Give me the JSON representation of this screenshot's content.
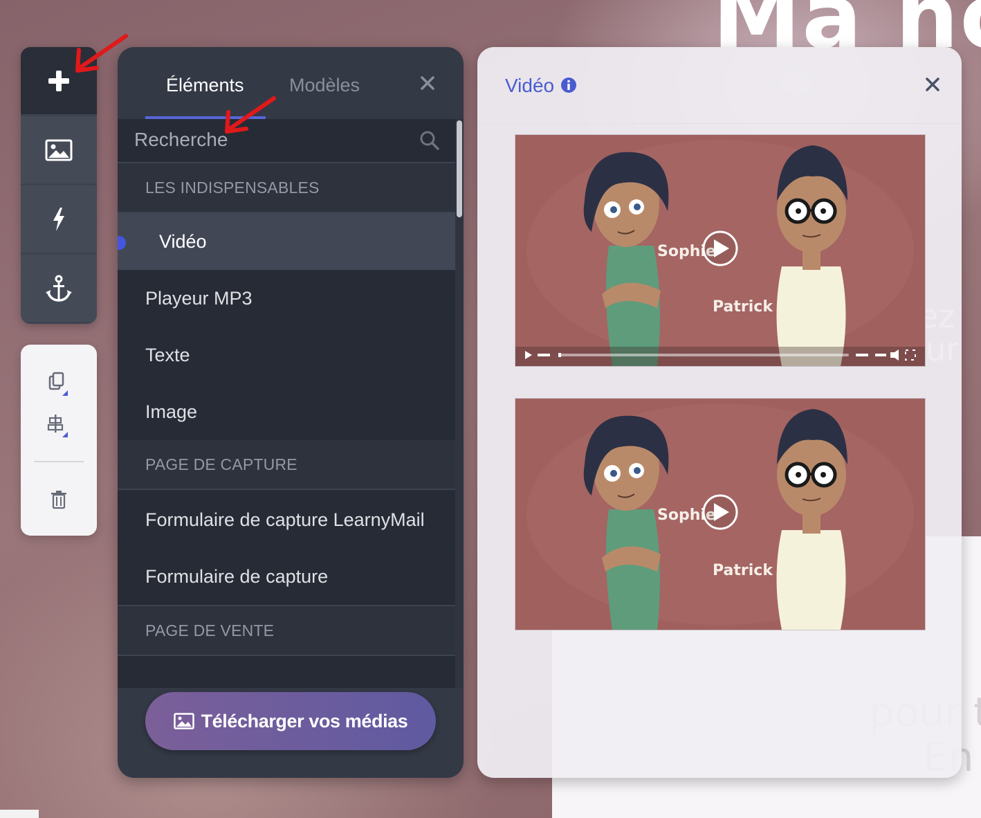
{
  "background": {
    "heading": "Ma no",
    "fragment_1": "rez",
    "fragment_2": "our",
    "fragment_3": "pour t",
    "fragment_4": "En"
  },
  "toolbar": {
    "buttons": [
      {
        "icon": "plus-icon"
      },
      {
        "icon": "image-icon"
      },
      {
        "icon": "lightning-icon"
      },
      {
        "icon": "anchor-icon"
      }
    ],
    "secondary": [
      {
        "icon": "copy-icon"
      },
      {
        "icon": "align-icon"
      },
      {
        "icon": "trash-icon"
      }
    ]
  },
  "panel": {
    "tabs": [
      {
        "label": "Éléments",
        "active": true
      },
      {
        "label": "Modèles",
        "active": false
      }
    ],
    "search_placeholder": "Recherche",
    "sections": [
      {
        "title": "LES INDISPENSABLES",
        "items": [
          "Vidéo",
          "Playeur MP3",
          "Texte",
          "Image"
        ]
      },
      {
        "title": "PAGE DE CAPTURE",
        "items": [
          "Formulaire de capture LearnyMail",
          "Formulaire de capture"
        ]
      },
      {
        "title": "PAGE DE VENTE",
        "items": []
      }
    ],
    "selected_item": "Vidéo",
    "upload_label": "Télécharger vos médias"
  },
  "video_panel": {
    "title": "Vidéo",
    "thumbnails": [
      {
        "name_left": "Sophie",
        "name_right": "Patrick",
        "has_controls": true
      },
      {
        "name_left": "Sophie",
        "name_right": "Patrick",
        "has_controls": false
      }
    ]
  },
  "colors": {
    "accent": "#4a5bd0",
    "panel_dark": "#343946",
    "list_bg": "#272b35",
    "thumb_bg": "#a0605e",
    "annotation_arrow": "#e0191a"
  }
}
